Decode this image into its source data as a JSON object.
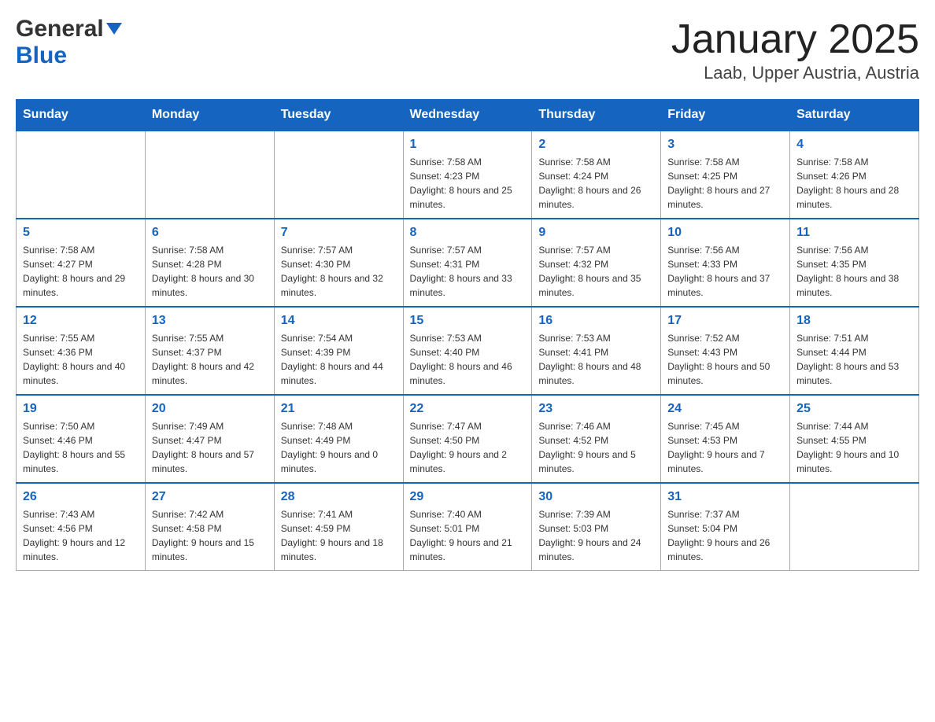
{
  "header": {
    "logo_general": "General",
    "logo_blue": "Blue",
    "title": "January 2025",
    "subtitle": "Laab, Upper Austria, Austria"
  },
  "days_of_week": [
    "Sunday",
    "Monday",
    "Tuesday",
    "Wednesday",
    "Thursday",
    "Friday",
    "Saturday"
  ],
  "weeks": [
    {
      "days": [
        {
          "number": "",
          "info": ""
        },
        {
          "number": "",
          "info": ""
        },
        {
          "number": "",
          "info": ""
        },
        {
          "number": "1",
          "info": "Sunrise: 7:58 AM\nSunset: 4:23 PM\nDaylight: 8 hours and 25 minutes."
        },
        {
          "number": "2",
          "info": "Sunrise: 7:58 AM\nSunset: 4:24 PM\nDaylight: 8 hours and 26 minutes."
        },
        {
          "number": "3",
          "info": "Sunrise: 7:58 AM\nSunset: 4:25 PM\nDaylight: 8 hours and 27 minutes."
        },
        {
          "number": "4",
          "info": "Sunrise: 7:58 AM\nSunset: 4:26 PM\nDaylight: 8 hours and 28 minutes."
        }
      ]
    },
    {
      "days": [
        {
          "number": "5",
          "info": "Sunrise: 7:58 AM\nSunset: 4:27 PM\nDaylight: 8 hours and 29 minutes."
        },
        {
          "number": "6",
          "info": "Sunrise: 7:58 AM\nSunset: 4:28 PM\nDaylight: 8 hours and 30 minutes."
        },
        {
          "number": "7",
          "info": "Sunrise: 7:57 AM\nSunset: 4:30 PM\nDaylight: 8 hours and 32 minutes."
        },
        {
          "number": "8",
          "info": "Sunrise: 7:57 AM\nSunset: 4:31 PM\nDaylight: 8 hours and 33 minutes."
        },
        {
          "number": "9",
          "info": "Sunrise: 7:57 AM\nSunset: 4:32 PM\nDaylight: 8 hours and 35 minutes."
        },
        {
          "number": "10",
          "info": "Sunrise: 7:56 AM\nSunset: 4:33 PM\nDaylight: 8 hours and 37 minutes."
        },
        {
          "number": "11",
          "info": "Sunrise: 7:56 AM\nSunset: 4:35 PM\nDaylight: 8 hours and 38 minutes."
        }
      ]
    },
    {
      "days": [
        {
          "number": "12",
          "info": "Sunrise: 7:55 AM\nSunset: 4:36 PM\nDaylight: 8 hours and 40 minutes."
        },
        {
          "number": "13",
          "info": "Sunrise: 7:55 AM\nSunset: 4:37 PM\nDaylight: 8 hours and 42 minutes."
        },
        {
          "number": "14",
          "info": "Sunrise: 7:54 AM\nSunset: 4:39 PM\nDaylight: 8 hours and 44 minutes."
        },
        {
          "number": "15",
          "info": "Sunrise: 7:53 AM\nSunset: 4:40 PM\nDaylight: 8 hours and 46 minutes."
        },
        {
          "number": "16",
          "info": "Sunrise: 7:53 AM\nSunset: 4:41 PM\nDaylight: 8 hours and 48 minutes."
        },
        {
          "number": "17",
          "info": "Sunrise: 7:52 AM\nSunset: 4:43 PM\nDaylight: 8 hours and 50 minutes."
        },
        {
          "number": "18",
          "info": "Sunrise: 7:51 AM\nSunset: 4:44 PM\nDaylight: 8 hours and 53 minutes."
        }
      ]
    },
    {
      "days": [
        {
          "number": "19",
          "info": "Sunrise: 7:50 AM\nSunset: 4:46 PM\nDaylight: 8 hours and 55 minutes."
        },
        {
          "number": "20",
          "info": "Sunrise: 7:49 AM\nSunset: 4:47 PM\nDaylight: 8 hours and 57 minutes."
        },
        {
          "number": "21",
          "info": "Sunrise: 7:48 AM\nSunset: 4:49 PM\nDaylight: 9 hours and 0 minutes."
        },
        {
          "number": "22",
          "info": "Sunrise: 7:47 AM\nSunset: 4:50 PM\nDaylight: 9 hours and 2 minutes."
        },
        {
          "number": "23",
          "info": "Sunrise: 7:46 AM\nSunset: 4:52 PM\nDaylight: 9 hours and 5 minutes."
        },
        {
          "number": "24",
          "info": "Sunrise: 7:45 AM\nSunset: 4:53 PM\nDaylight: 9 hours and 7 minutes."
        },
        {
          "number": "25",
          "info": "Sunrise: 7:44 AM\nSunset: 4:55 PM\nDaylight: 9 hours and 10 minutes."
        }
      ]
    },
    {
      "days": [
        {
          "number": "26",
          "info": "Sunrise: 7:43 AM\nSunset: 4:56 PM\nDaylight: 9 hours and 12 minutes."
        },
        {
          "number": "27",
          "info": "Sunrise: 7:42 AM\nSunset: 4:58 PM\nDaylight: 9 hours and 15 minutes."
        },
        {
          "number": "28",
          "info": "Sunrise: 7:41 AM\nSunset: 4:59 PM\nDaylight: 9 hours and 18 minutes."
        },
        {
          "number": "29",
          "info": "Sunrise: 7:40 AM\nSunset: 5:01 PM\nDaylight: 9 hours and 21 minutes."
        },
        {
          "number": "30",
          "info": "Sunrise: 7:39 AM\nSunset: 5:03 PM\nDaylight: 9 hours and 24 minutes."
        },
        {
          "number": "31",
          "info": "Sunrise: 7:37 AM\nSunset: 5:04 PM\nDaylight: 9 hours and 26 minutes."
        },
        {
          "number": "",
          "info": ""
        }
      ]
    }
  ]
}
